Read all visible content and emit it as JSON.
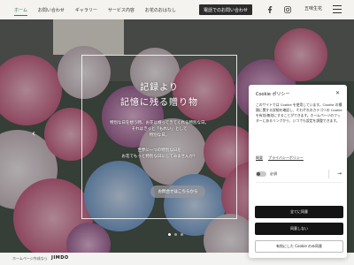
{
  "header": {
    "nav": [
      "ホーム",
      "お問い合わせ",
      "ギャラリー",
      "サービス内容",
      "お花のおはなし"
    ],
    "active_index": 0,
    "phone_button": "電話でのお問い合わせ",
    "brand_name": "五味生花"
  },
  "hero": {
    "title_line1": "記録より",
    "title_line2": "記憶に残る贈り物",
    "para1_lines": [
      "特別な日を想う時、お花は特ってきてくれる特別な日。",
      "それはきっと「もれい」として",
      "特別な日。"
    ],
    "para2_lines": [
      "世界に一つの特別な日を",
      "お花でもっと特別な日にしてみませんか？"
    ],
    "cta": "お問合せはこちらから",
    "arrow_left": "‹",
    "slide_count": 3,
    "active_slide": 0
  },
  "footer": {
    "made_with": "ホームページ作成なら",
    "jimdo": "JIMDO"
  },
  "cookie": {
    "title": "Cookie ポリシー",
    "close": "✕",
    "body": "このサイトでは Cookie を使用しています。Cookie の種類に関する詳細を確認し、それぞれのカテゴリの Cookie を有効/無効にすることができます。ホームページのフッターにあるリンクから、いつでも設定を調整できます。",
    "link1": "概要",
    "link2": "プライバシーポリシー",
    "required_label": "必須",
    "btn_all": "全てに同意",
    "btn_deny": "同意しない",
    "btn_selected": "有効にした Cookie のみ同意"
  }
}
